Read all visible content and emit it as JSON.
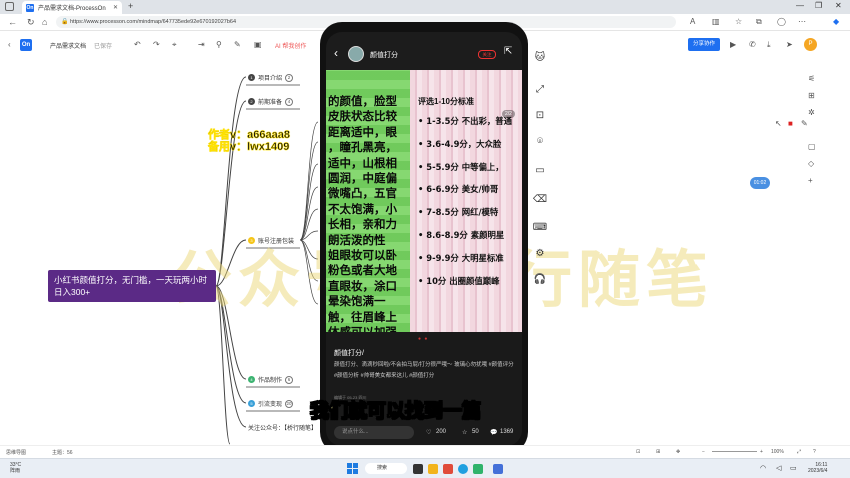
{
  "browser": {
    "tab_title": "产品需求文档-ProcessOn",
    "url": "https://www.processon.com/mindmap/647735ede92e670192027b64"
  },
  "app": {
    "doc_title": "产品需求文档",
    "saved_label": "已保存",
    "ai_label": "AI 帮我创作",
    "share_label": "分享协作",
    "avatar_letter": "P"
  },
  "mindmap": {
    "root": "小红书颜值打分，无门槛，一天玩两小时日入300+",
    "branches": [
      {
        "label": "项目介绍",
        "num": "1",
        "count": "2"
      },
      {
        "label": "前期准备",
        "num": "2",
        "count": "4"
      },
      {
        "label": "账号注册包装",
        "num": "3",
        "count": ""
      },
      {
        "label": "作品制作",
        "num": "4",
        "count": "6"
      },
      {
        "label": "引流变现",
        "num": "5",
        "count": "20"
      },
      {
        "label": "关注公众号：【桥行随笔】",
        "num": "",
        "count": ""
      }
    ]
  },
  "overlay": {
    "author_line1": "作者v：a66aaa8",
    "author_line2": "备用v：lwx1409",
    "watermark": "公众号：桥行随笔",
    "subtitle": "我们就可以找到一篇"
  },
  "phone": {
    "username": "颜值打分",
    "follow": "关注",
    "pager": "2/2",
    "photo_left_text": "的颜值，脸型\n皮肤状态比较\n距离适中，眼\n，瞳孔黑亮，\n适中，山根相\n圆润，中庭偏\n微嘴凸，五官\n不太饱满，小\n长相，亲和力\n朗活泼的性\n姐眼妆可以卧\n粉色或者大地\n直眼妆，涂口\n晕染饱满一\n触，往眉峰上\n体感可以加强",
    "scores": [
      "1-3.5分 不出彩，普通",
      "3.6-4.9分，大众脸",
      "5-5.9分 中等偏上，",
      "6-6.9分 美女/帅哥",
      "7-8.5分 网红/模特",
      "8.6-8.9分 素颜明星",
      "9-9.9分 大明星标准",
      "10分 出圈颜值巅峰"
    ],
    "scores_head": "评选1-10分标准",
    "post_title": "颜值打分/",
    "post_desc": "颜值打分、滴滴秒回啦/不会拍马屁/打分很严哦～ 玻璃心勿扰哦 #颜值评分 #颜值分析 #帅哥美女都来这儿 #颜值打分",
    "post_date": "编辑于 05-23 四川",
    "comment_placeholder": "说点什么...",
    "likes": "200",
    "stars": "50",
    "comments": "1369"
  },
  "status": {
    "left": "思维导图",
    "topic_count": "主题：56",
    "zoom": "100%"
  },
  "taskbar": {
    "temp": "33°C",
    "weather": "阵雨",
    "search": "搜索",
    "time": "16:11",
    "date": "2023/6/4"
  },
  "timer": "01:02",
  "colors": {
    "accent": "#1e6ff0",
    "root_bg": "#5b2a86",
    "highlight": "#f5c518"
  }
}
